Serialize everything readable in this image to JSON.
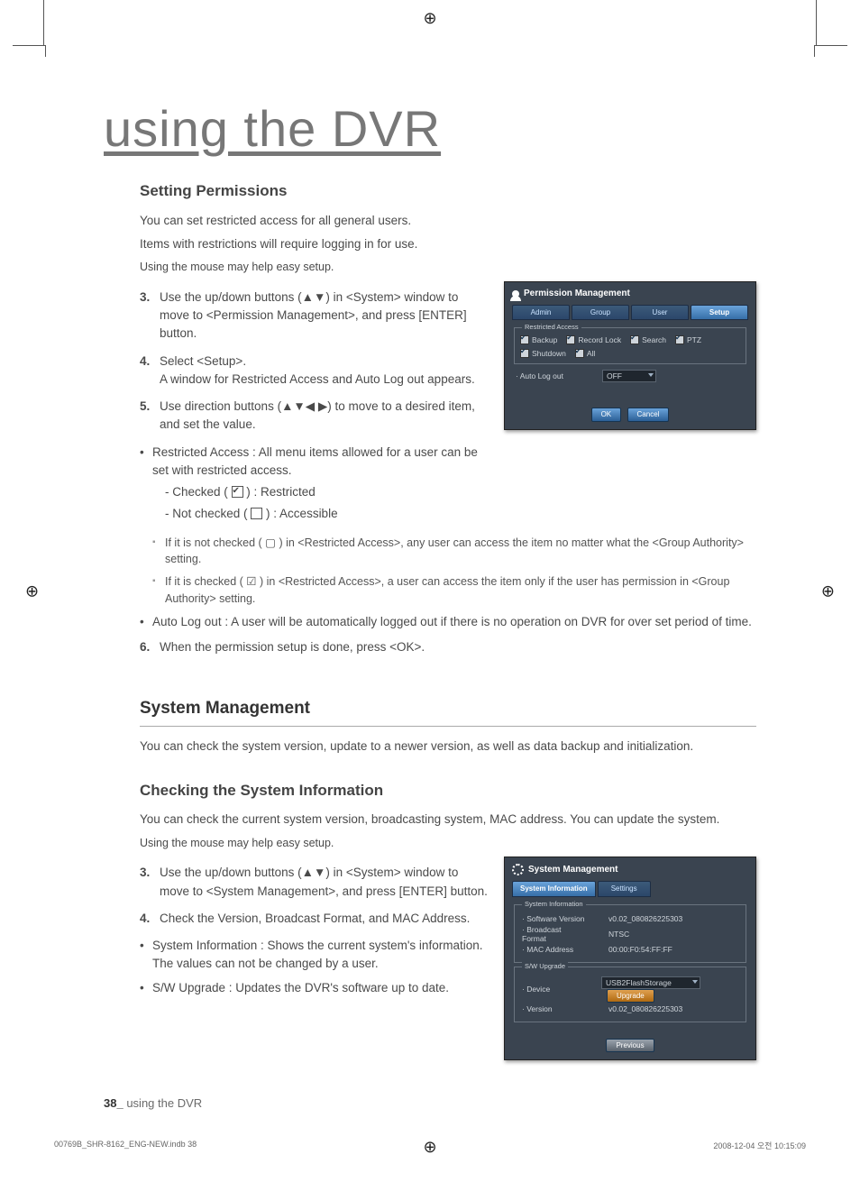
{
  "page": {
    "title": "using the DVR",
    "footer_page": "38_",
    "footer_text": "using the DVR",
    "print_left": "00769B_SHR-8162_ENG-NEW.indb   38",
    "print_right": "2008-12-04   오전 10:15:09"
  },
  "perm": {
    "heading": "Setting Permissions",
    "intro1": "You can set restricted access for all general users.",
    "intro2": "Items with restrictions will require logging in for use.",
    "intro3": "Using the mouse may help easy setup.",
    "steps": {
      "s3_num": "3.",
      "s3": "Use the up/down buttons (▲▼) in <System> window to move to <Permission Management>, and press [ENTER] button.",
      "s4_num": "4.",
      "s4": "Select <Setup>.\nA window for Restricted Access and Auto Log out appears.",
      "s5_num": "5.",
      "s5": "Use direction buttons (▲▼◀ ▶) to move to a desired item, and set the value.",
      "s6_num": "6.",
      "s6": "When the permission setup is done, press <OK>."
    },
    "bullets": {
      "ra": "Restricted Access : All menu items allowed for a user can be set with restricted access.",
      "checked": "- Checked ( ",
      "checked2": " ) : Restricted",
      "unchecked": "- Not checked ( ",
      "unchecked2": " ) : Accessible",
      "note1": "If it is not checked ( ▢ ) in <Restricted Access>, any user can access the item no matter what the <Group Authority> setting.",
      "note2": "If it is checked ( ☑ ) in <Restricted Access>, a user can access the item only if the user has permission in <Group Authority> setting.",
      "alo": "Auto Log out : A user will be automatically logged out if there is no operation on DVR for over set period of time."
    },
    "panel": {
      "title": "Permission Management",
      "tabs": [
        "Admin",
        "Group",
        "User",
        "Setup"
      ],
      "active_tab": 3,
      "legend_ra": "Restricted Access",
      "chks": {
        "backup": "Backup",
        "recordlock": "Record Lock",
        "search": "Search",
        "ptz": "PTZ",
        "shutdown": "Shutdown",
        "all": "All"
      },
      "autolog_label": "· Auto Log out",
      "autolog_value": "OFF",
      "ok": "OK",
      "cancel": "Cancel"
    }
  },
  "sysmgmt": {
    "heading": "System Management",
    "intro": "You can check the system version, update to a newer version, as well as data backup and initialization.",
    "sub": "Checking the System Information",
    "desc1": "You can check the current system version, broadcasting system, MAC address. You can update the system.",
    "desc2": "Using the mouse may help easy setup.",
    "steps": {
      "s3_num": "3.",
      "s3": "Use the up/down buttons (▲▼) in <System> window to move to <System Management>, and press [ENTER] button.",
      "s4_num": "4.",
      "s4": "Check the Version, Broadcast Format, and MAC Address."
    },
    "bullets": {
      "si": "System Information : Shows the current system's information.\nThe values can not be changed by a user.",
      "sw": "S/W Upgrade : Updates the DVR's software up to date."
    },
    "panel": {
      "title": "System Management",
      "tabs": [
        "System Information",
        "Settings"
      ],
      "active_tab": 0,
      "legend_si": "System Information",
      "rows": {
        "swver_l": "· Software Version",
        "swver_v": "v0.02_080826225303",
        "bf_l": "· Broadcast Format",
        "bf_v": "NTSC",
        "mac_l": "· MAC Address",
        "mac_v": "00:00:F0:54:FF:FF"
      },
      "legend_sw": "S/W Upgrade",
      "dev_l": "· Device",
      "dev_v": "USB2FlashStorage",
      "ver_l": "· Version",
      "ver_v": "v0.02_080826225303",
      "upgrade": "Upgrade",
      "previous": "Previous"
    }
  }
}
